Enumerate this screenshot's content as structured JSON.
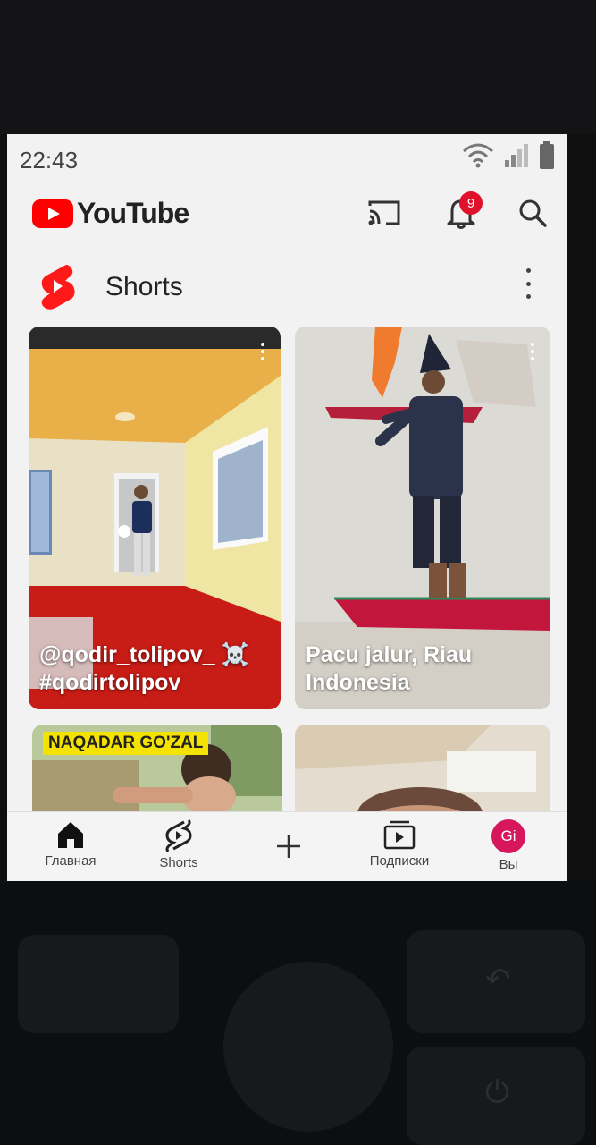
{
  "status": {
    "time": "22:43"
  },
  "header": {
    "logo_text": "YouTube",
    "notification_count": "9"
  },
  "shelf": {
    "title": "Shorts"
  },
  "cards": [
    {
      "title": "@qodir_tolipov_ ☠️\n#qodirtolipov"
    },
    {
      "title": "Pacu jalur, Riau\nIndonesia"
    },
    {
      "overlay_text": "NAQADAR GO'ZAL"
    },
    {
      "overlay_text": ""
    }
  ],
  "nav": {
    "home": "Главная",
    "shorts": "Shorts",
    "subscriptions": "Подписки",
    "you": "Вы",
    "avatar_initials": "Gi"
  },
  "icons": [
    "wifi-icon",
    "signal-icon",
    "battery-icon",
    "cast-icon",
    "bell-icon",
    "search-icon",
    "shorts-logo-icon",
    "more-vert-icon",
    "home-icon",
    "shorts-icon",
    "add-icon",
    "subscriptions-icon"
  ],
  "colors": {
    "brand_red": "#ff0000",
    "badge_red": "#e0112b",
    "avatar": "#d6175b"
  }
}
